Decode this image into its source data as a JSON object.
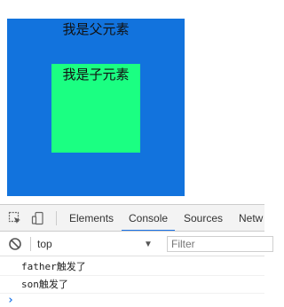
{
  "page": {
    "father_label": "我是父元素",
    "son_label": "我是子元素",
    "father_color": "#1273dd",
    "son_color": "#1bff82"
  },
  "devtools": {
    "icons": [
      "inspect-element-icon",
      "device-toolbar-icon"
    ],
    "tabs": [
      "Elements",
      "Console",
      "Sources",
      "Netw"
    ],
    "active_tab": "Console",
    "console": {
      "context": "top",
      "filter_placeholder": "Filter",
      "logs": [
        "father触发了",
        "son触发了"
      ],
      "prompt_symbol": "›"
    }
  }
}
